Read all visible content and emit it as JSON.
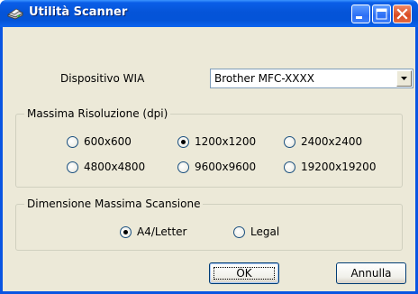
{
  "window": {
    "title": "Utilità Scanner",
    "icon": "scanner-icon",
    "controls": [
      "minimize-icon",
      "maximize-icon",
      "close-icon"
    ],
    "title_color": "#0554d8",
    "close_color": "#d94a21"
  },
  "device": {
    "label": "Dispositivo WIA",
    "selected": "Brother MFC-XXXX"
  },
  "resolution": {
    "title": "Massima Risoluzione (dpi)",
    "options": [
      "600x600",
      "1200x1200",
      "2400x2400",
      "4800x4800",
      "9600x9600",
      "19200x19200"
    ],
    "selected": "1200x1200"
  },
  "scan_size": {
    "title": "Dimensione Massima Scansione",
    "options": [
      "A4/Letter",
      "Legal"
    ],
    "selected": "A4/Letter"
  },
  "buttons": {
    "ok": "OK",
    "cancel": "Annulla"
  }
}
